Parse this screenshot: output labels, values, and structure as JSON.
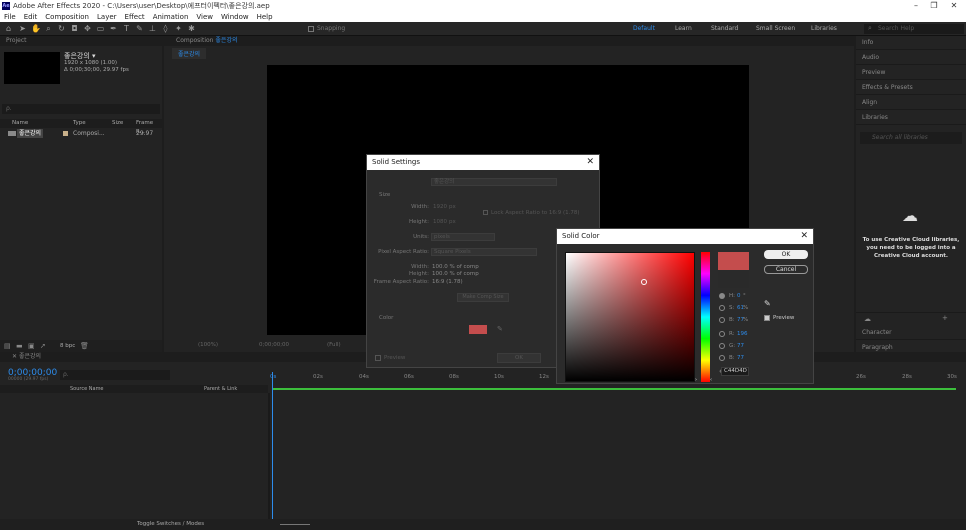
{
  "window": {
    "title": "Adobe After Effects 2020 - C:\\Users\\user\\Desktop\\에프터이펙터\\좋은강의.aep",
    "min": "–",
    "max": "❐",
    "close": "✕",
    "logo": "Ae"
  },
  "menu": [
    "File",
    "Edit",
    "Composition",
    "Layer",
    "Effect",
    "Animation",
    "View",
    "Window",
    "Help"
  ],
  "toolbar": {
    "snapping": "Snapping",
    "workspaces": [
      "Default",
      "Learn",
      "Standard",
      "Small Screen",
      "Libraries"
    ],
    "search_placeholder": "Search Help"
  },
  "project": {
    "title": "Project",
    "comp_name": "좋은강의 ▾",
    "comp_size": "1920 x 1080 (1.00)",
    "comp_duration": "Δ 0;00;30;00, 29.97 fps",
    "search_placeholder": "ρ.",
    "columns": [
      "Name",
      "Type",
      "Size",
      "Frame R..."
    ],
    "rows": [
      {
        "name": "좋은강의",
        "type": "Composi...",
        "size": "",
        "fps": "29.97"
      }
    ],
    "bpc": "8 bpc"
  },
  "composition": {
    "tab_prefix": "Composition",
    "tab_name": "좋은강의",
    "subtab": "좋은강의",
    "zoom": "(100%)",
    "timecode": "0;00;00;00",
    "quality": "(Full)"
  },
  "right_panel": {
    "items": [
      "Info",
      "Audio",
      "Preview",
      "Effects & Presets",
      "Align",
      "Libraries"
    ],
    "lib_search": "Search all libraries",
    "cc_message": "To use Creative Cloud libraries, you need to be logged into a Creative Cloud account.",
    "bottom": [
      "Character",
      "Paragraph"
    ]
  },
  "timeline": {
    "tab": "좋은강의",
    "timecode": "0;00;00;00",
    "timecode_sub": "00000 (29.97 fps)",
    "search": "ρ.",
    "col_source": "Source Name",
    "col_parent": "Parent & Link",
    "ruler": [
      "0s",
      "02s",
      "04s",
      "06s",
      "08s",
      "10s",
      "12s",
      "26s",
      "28s",
      "30s"
    ],
    "toggle": "Toggle Switches / Modes"
  },
  "solid_settings": {
    "title": "Solid Settings",
    "name_label": "Name:",
    "name_value": "좋은강의",
    "size_label": "Size",
    "width_label": "Width:",
    "width_value": "1920",
    "px": "px",
    "height_label": "Height:",
    "height_value": "1080",
    "lock": "Lock Aspect Ratio to 16:9 (1.78)",
    "units_label": "Units:",
    "units_value": "pixels",
    "par_label": "Pixel Aspect Ratio:",
    "par_value": "Square Pixels",
    "w_pct_label": "Width:",
    "w_pct": "100.0 % of comp",
    "h_pct_label": "Height:",
    "h_pct": "100.0 % of comp",
    "far_label": "Frame Aspect Ratio:",
    "far": "16:9 (1.78)",
    "make_comp": "Make Comp Size",
    "color_label": "Color",
    "preview": "Preview",
    "ok": "OK",
    "swatch": "#c44d4d"
  },
  "solid_color": {
    "title": "Solid Color",
    "ok": "OK",
    "cancel": "Cancel",
    "preview": "Preview",
    "h_label": "H:",
    "h_val": "0",
    "h_unit": "°",
    "s_label": "S:",
    "s_val": "61",
    "s_unit": "%",
    "b_label": "B:",
    "b_val": "77",
    "b_unit": "%",
    "r_label": "R:",
    "r_val": "196",
    "g_label": "G:",
    "g_val": "77",
    "bb_label": "B:",
    "bb_val": "77",
    "hex_label": "#",
    "hex": "C44D4D",
    "new_color": "#c44d4d",
    "old_color": "#2a2a2a"
  }
}
